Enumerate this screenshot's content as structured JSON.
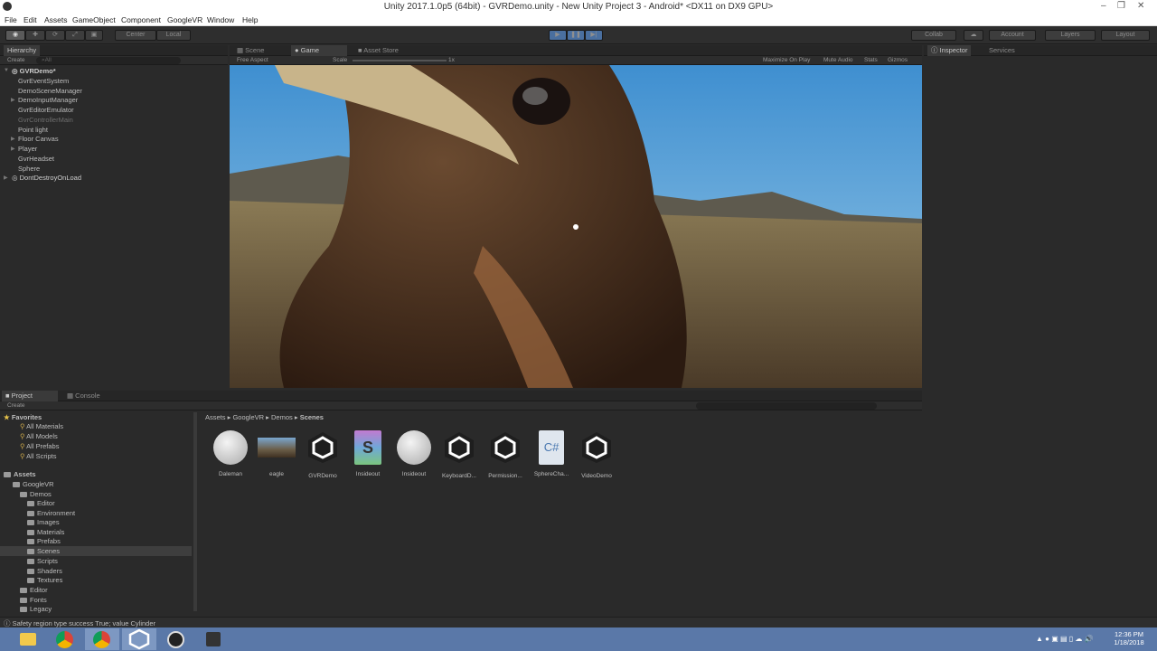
{
  "window": {
    "title": "Unity 2017.1.0p5 (64bit) - GVRDemo.unity - New Unity Project 3 - Android* <DX11 on DX9 GPU>"
  },
  "menu": [
    "File",
    "Edit",
    "Assets",
    "GameObject",
    "Component",
    "GoogleVR",
    "Window",
    "Help"
  ],
  "toolbar": {
    "pivot": "Center",
    "space": "Local",
    "collab": "Collab",
    "account": "Account",
    "layers": "Layers",
    "layout": "Layout"
  },
  "hierarchy": {
    "tab": "Hierarchy",
    "create": "Create",
    "search_placeholder": "⌕All",
    "scene": "GVRDemo*",
    "items": [
      "GvrEventSystem",
      "DemoSceneManager",
      "DemoInputManager",
      "GvrEditorEmulator",
      "GvrControllerMain",
      "Point light",
      "Floor Canvas",
      "Player",
      "GvrHeadset",
      "Sphere"
    ],
    "dontdestroy": "DontDestroyOnLoad"
  },
  "view_tabs": {
    "scene": "Scene",
    "game": "Game",
    "asset_store": "Asset Store"
  },
  "game_bar": {
    "aspect": "Free Aspect",
    "scale_label": "Scale",
    "scale_value": "1x",
    "maximize": "Maximize On Play",
    "mute": "Mute Audio",
    "stats": "Stats",
    "gizmos": "Gizmos"
  },
  "inspector": {
    "tab": "Inspector",
    "services": "Services"
  },
  "project": {
    "tab": "Project",
    "console": "Console",
    "create": "Create",
    "favorites_label": "Favorites",
    "favorites": [
      "All Materials",
      "All Models",
      "All Prefabs",
      "All Scripts"
    ],
    "assets_label": "Assets",
    "tree": {
      "googlevr": "GoogleVR",
      "demos": "Demos",
      "demo_children": [
        "Editor",
        "Environment",
        "Images",
        "Materials",
        "Prefabs",
        "Scenes",
        "Scripts",
        "Shaders",
        "Textures"
      ],
      "others": [
        "Editor",
        "Fonts",
        "Legacy"
      ]
    },
    "breadcrumb": {
      "a": "Assets",
      "b": "GoogleVR",
      "c": "Demos",
      "d": "Scenes"
    },
    "assets": [
      {
        "label": "Daleman",
        "icon": "material-sphere-icon"
      },
      {
        "label": "eagle",
        "icon": "image-texture-icon"
      },
      {
        "label": "GVRDemo",
        "icon": "unity-scene-icon"
      },
      {
        "label": "Insideout",
        "icon": "shader-icon"
      },
      {
        "label": "Insideout",
        "icon": "material-sphere-icon"
      },
      {
        "label": "KeyboardD...",
        "icon": "unity-scene-icon"
      },
      {
        "label": "Permission...",
        "icon": "unity-scene-icon"
      },
      {
        "label": "SphereCha...",
        "icon": "csharp-script-icon"
      },
      {
        "label": "VideoDemo",
        "icon": "unity-scene-icon"
      }
    ]
  },
  "status": "Safety region type success True; value Cylinder",
  "taskbar": {
    "time": "12:36 PM",
    "date": "1/18/2018"
  },
  "colors": {
    "accent_play": "#4a6f9f",
    "taskbar": "#5a78a8"
  }
}
